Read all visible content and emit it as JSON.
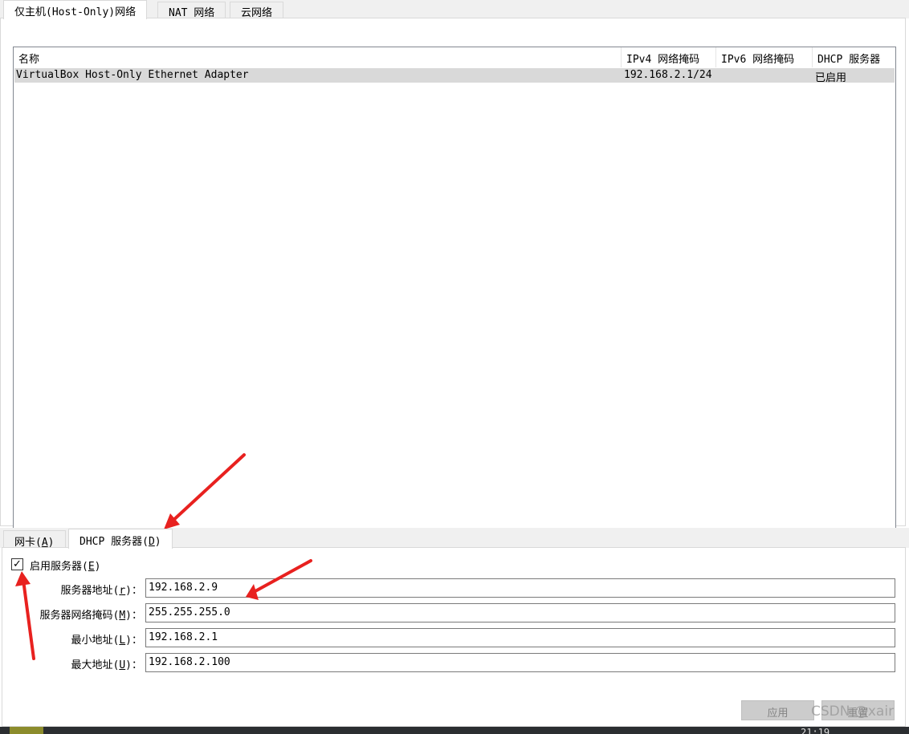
{
  "top_tabs": [
    {
      "label": "仅主机(Host-Only)网络",
      "active": true
    },
    {
      "label": "NAT 网络",
      "active": false
    },
    {
      "label": "云网络",
      "active": false
    }
  ],
  "table": {
    "sort_indicator": "^",
    "columns": [
      "名称",
      "IPv4 网络掩码",
      "IPv6 网络掩码",
      "DHCP 服务器"
    ],
    "rows": [
      {
        "name": "VirtualBox Host-Only Ethernet Adapter",
        "ipv4": "192.168.2.1/24",
        "ipv6": "",
        "dhcp": "已启用"
      }
    ]
  },
  "bottom_tabs": [
    {
      "label": "网卡",
      "mnemonic": "A",
      "active": false
    },
    {
      "label": "DHCP 服务器",
      "mnemonic": "D",
      "active": true
    }
  ],
  "dhcp": {
    "enable_label": "启用服务器",
    "enable_mnemonic": "E",
    "enabled": true,
    "check_glyph": "✓",
    "fields": [
      {
        "label": "服务器地址",
        "mnemonic": "r",
        "value": "192.168.2.9"
      },
      {
        "label": "服务器网络掩码",
        "mnemonic": "M",
        "value": "255.255.255.0"
      },
      {
        "label": "最小地址",
        "mnemonic": "L",
        "value": "192.168.2.1"
      },
      {
        "label": "最大地址",
        "mnemonic": "U",
        "value": "192.168.2.100"
      }
    ]
  },
  "buttons": {
    "apply": "应用",
    "reset": "重置"
  },
  "watermark": "CSDN @xair",
  "taskbar_time": "21:19",
  "colors": {
    "annotation_arrow": "#e8211f",
    "selected_row": "#d9d9d9",
    "tab_bar": "#f0f0f0"
  }
}
